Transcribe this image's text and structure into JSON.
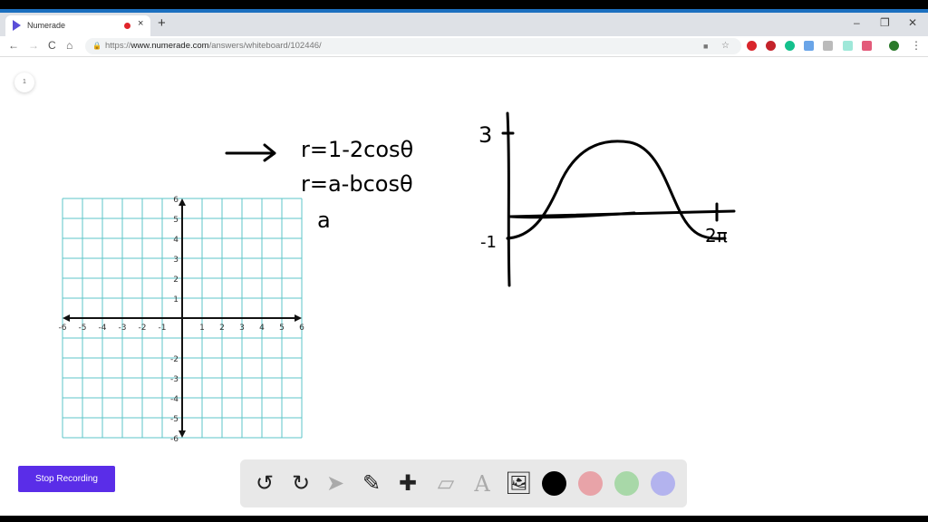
{
  "browser": {
    "tab_title": "Numerade",
    "tab_close": "×",
    "new_tab": "+",
    "url_prefix": "https://",
    "url_host": "www.numerade.com",
    "url_path": "/answers/whiteboard/102446/",
    "window_controls": {
      "minimize": "–",
      "maximize": "❐",
      "close": "✕"
    },
    "nav": {
      "back": "←",
      "forward": "→",
      "reload": "C",
      "home": "⌂"
    },
    "extension_colors": [
      "#d9262c",
      "#c4232b",
      "#14c08c",
      "#6aa5e8",
      "#bbbbbb",
      "#9fe8d9",
      "#e35b7a",
      "#2b7a2b"
    ]
  },
  "whiteboard": {
    "page_number": "1",
    "grid": {
      "x_ticks": [
        "-6",
        "-5",
        "-4",
        "-3",
        "-2",
        "-1",
        "1",
        "2",
        "3",
        "4",
        "5",
        "6"
      ],
      "y_ticks": [
        "6",
        "5",
        "4",
        "3",
        "2",
        "1",
        "-2",
        "-3",
        "-4",
        "-5",
        "-6"
      ],
      "grid_color": "#5cc6c9"
    },
    "handwriting": {
      "eq1": "r=1-2cosθ",
      "eq2": "r=a-bcosθ",
      "note": "a",
      "y_label_top": "3",
      "y_label_bottom": "-1",
      "x_label": "2π"
    }
  },
  "stop_recording": "Stop Recording",
  "tools": {
    "items": [
      {
        "name": "undo",
        "glyph": "↺"
      },
      {
        "name": "redo",
        "glyph": "↻"
      },
      {
        "name": "pointer",
        "glyph": "➤"
      },
      {
        "name": "pencil",
        "glyph": "✎"
      },
      {
        "name": "add",
        "glyph": "✚"
      },
      {
        "name": "eraser",
        "glyph": "▱"
      },
      {
        "name": "text",
        "glyph": "A"
      },
      {
        "name": "image",
        "glyph": "🖼"
      }
    ],
    "colors": [
      "#000000",
      "#e8a3a8",
      "#a8d8a8",
      "#b3b3ee"
    ]
  }
}
